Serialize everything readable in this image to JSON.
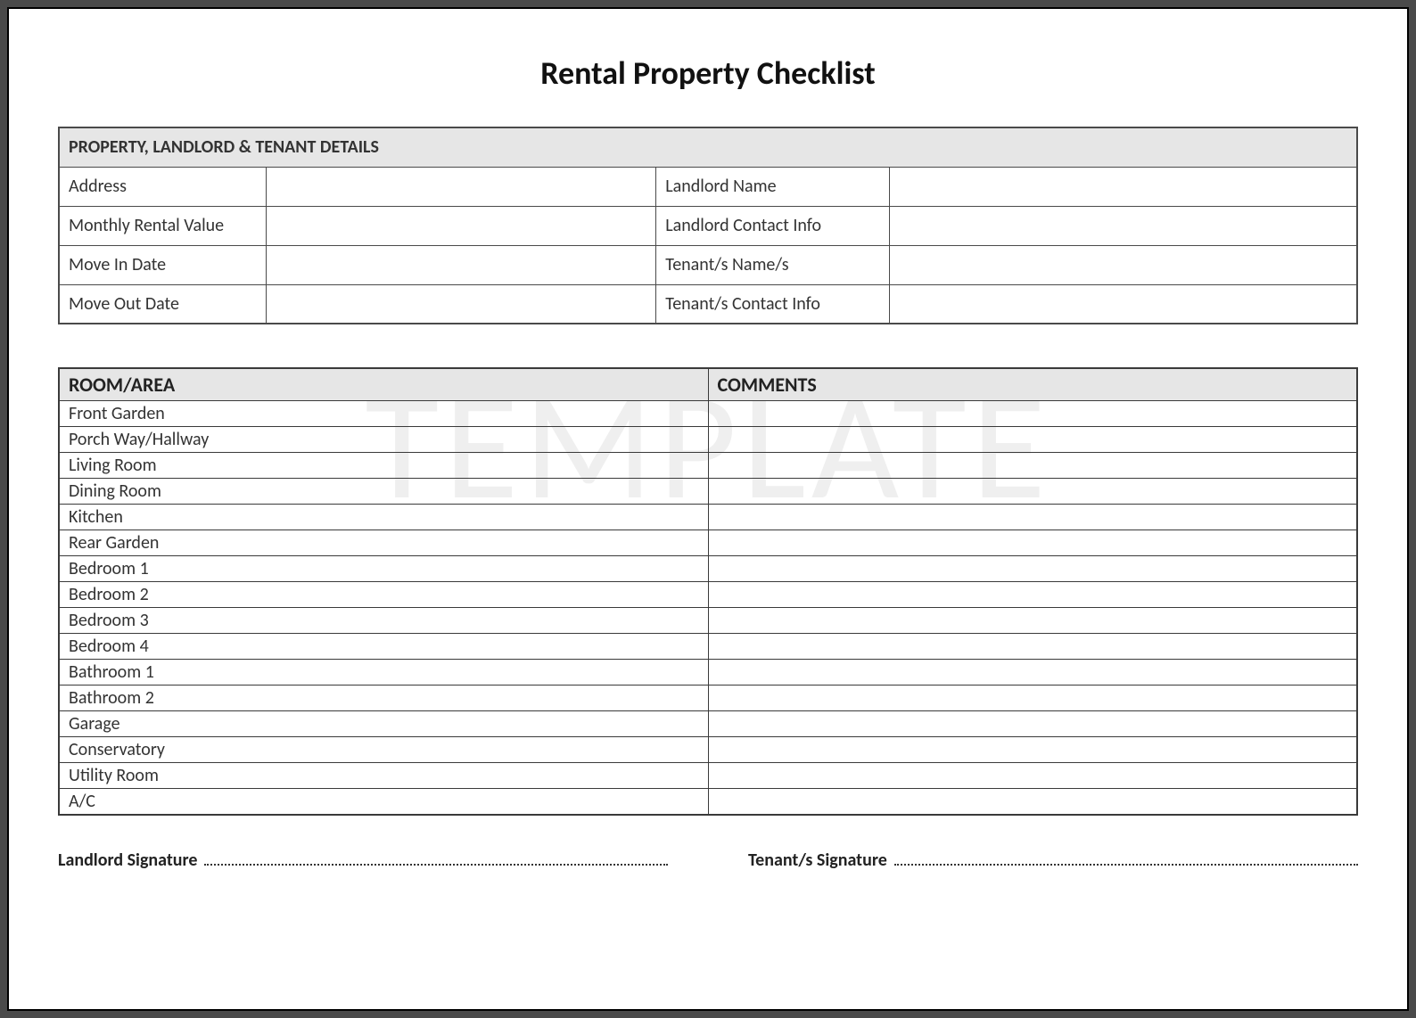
{
  "title": "Rental Property Checklist",
  "watermark": "TEMPLATE",
  "details": {
    "section_header": "PROPERTY, LANDLORD & TENANT DETAILS",
    "rows": [
      {
        "left_label": "Address",
        "left_value": "",
        "right_label": "Landlord Name",
        "right_value": ""
      },
      {
        "left_label": "Monthly Rental Value",
        "left_value": "",
        "right_label": "Landlord Contact Info",
        "right_value": ""
      },
      {
        "left_label": "Move In Date",
        "left_value": "",
        "right_label": "Tenant/s Name/s",
        "right_value": ""
      },
      {
        "left_label": "Move Out Date",
        "left_value": "",
        "right_label": "Tenant/s Contact Info",
        "right_value": ""
      }
    ]
  },
  "rooms": {
    "header_room": "ROOM/AREA",
    "header_comments": "COMMENTS",
    "items": [
      {
        "name": "Front Garden",
        "comment": ""
      },
      {
        "name": "Porch Way/Hallway",
        "comment": ""
      },
      {
        "name": "Living Room",
        "comment": ""
      },
      {
        "name": "Dining Room",
        "comment": ""
      },
      {
        "name": "Kitchen",
        "comment": ""
      },
      {
        "name": "Rear Garden",
        "comment": ""
      },
      {
        "name": "Bedroom 1",
        "comment": ""
      },
      {
        "name": "Bedroom 2",
        "comment": ""
      },
      {
        "name": "Bedroom 3",
        "comment": ""
      },
      {
        "name": "Bedroom 4",
        "comment": ""
      },
      {
        "name": "Bathroom 1",
        "comment": ""
      },
      {
        "name": "Bathroom 2",
        "comment": ""
      },
      {
        "name": "Garage",
        "comment": ""
      },
      {
        "name": "Conservatory",
        "comment": ""
      },
      {
        "name": "Utility Room",
        "comment": ""
      },
      {
        "name": "A/C",
        "comment": ""
      }
    ]
  },
  "signatures": {
    "landlord_label": "Landlord Signature",
    "tenant_label": "Tenant/s Signature"
  }
}
